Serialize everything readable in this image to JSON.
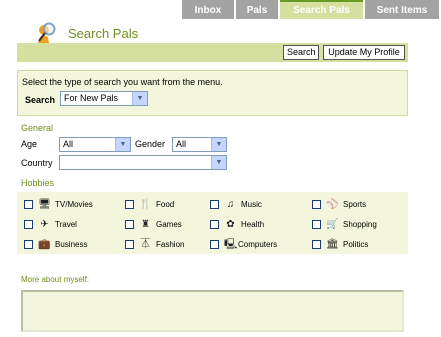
{
  "tabs": [
    {
      "label": "Inbox"
    },
    {
      "label": "Pals"
    },
    {
      "label": "Search Pals"
    },
    {
      "label": "Sent Items"
    }
  ],
  "header": {
    "title": "Search Pals"
  },
  "toolbar": {
    "search_label": "Search",
    "update_label": "Update My Profile"
  },
  "search_type": {
    "instruction": "Select the type of search you want from the menu.",
    "label": "Search",
    "selected": "For New Pals"
  },
  "general": {
    "heading": "General",
    "age_label": "Age",
    "age_value": "All",
    "gender_label": "Gender",
    "gender_value": "All",
    "country_label": "Country",
    "country_value": ""
  },
  "hobbies": {
    "heading": "Hobbies",
    "items": [
      {
        "label": "TV/Movies",
        "icon": "tv-icon"
      },
      {
        "label": "Food",
        "icon": "fork-knife-icon"
      },
      {
        "label": "Music",
        "icon": "music-note-icon"
      },
      {
        "label": "Sports",
        "icon": "sports-icon"
      },
      {
        "label": "Travel",
        "icon": "airplane-icon"
      },
      {
        "label": "Games",
        "icon": "joystick-icon"
      },
      {
        "label": "Health",
        "icon": "health-icon"
      },
      {
        "label": "Shopping",
        "icon": "shopping-cart-icon"
      },
      {
        "label": "Business",
        "icon": "briefcase-icon"
      },
      {
        "label": "Fashion",
        "icon": "hanger-icon"
      },
      {
        "label": "Computers",
        "icon": "computer-icon"
      },
      {
        "label": "Politics",
        "icon": "politics-icon"
      }
    ]
  },
  "about": {
    "label": "More about myself:"
  },
  "colors": {
    "accent_green": "#6f8f20",
    "panel_bg": "#f3f6dc",
    "toolbar_bg": "#d5e09e",
    "tab_gray": "#a3a3a3"
  }
}
